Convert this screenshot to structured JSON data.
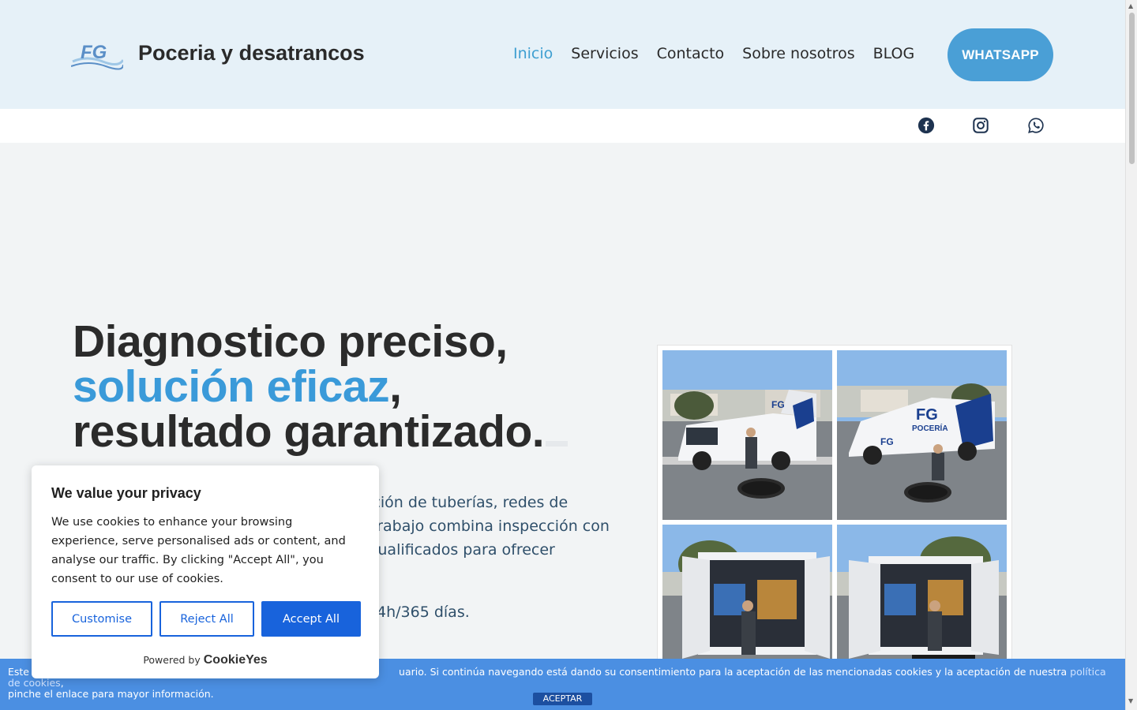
{
  "header": {
    "brand": "Poceria y desatrancos",
    "logo_text": "FG",
    "nav": [
      {
        "label": "Inicio",
        "active": true
      },
      {
        "label": "Servicios",
        "active": false
      },
      {
        "label": "Contacto",
        "active": false
      },
      {
        "label": "Sobre nosotros",
        "active": false
      },
      {
        "label": "BLOG",
        "active": false
      }
    ],
    "whatsapp_button": "WHATSAPP"
  },
  "social": {
    "icons": [
      "facebook-icon",
      "instagram-icon",
      "whatsapp-icon"
    ]
  },
  "hero": {
    "title_line1": "Diagnostico preciso,",
    "title_highlight": "solución eficaz",
    "title_comma": ",",
    "title_line3": "resultado garantizado.",
    "text_line1": "ración de tuberías, redes de",
    "text_line2": "e trabajo combina inspección con",
    "text_line3": "s cualificados para ofrecer",
    "text_line4": "4h/365 días.",
    "photos_alt": [
      "FG Poceria van with technician 1",
      "FG Poceria van with technician 2",
      "FG Poceria van rear doors 1",
      "FG Poceria van rear doors 2"
    ]
  },
  "consent": {
    "title": "We value your privacy",
    "body": "We use cookies to enhance your browsing experience, serve personalised ads or content, and analyse our traffic. By clicking \"Accept All\", you consent to our use of cookies.",
    "customise": "Customise",
    "reject": "Reject All",
    "accept": "Accept All",
    "powered_by": "Powered by",
    "powered_brand": "CookieYes"
  },
  "legacy_banner": {
    "text_left": "Este",
    "text_mid": "uario. Si continúa navegando está dando su consentimiento para la aceptación de las mencionadas cookies y la aceptación de nuestra",
    "link": "política de cookies",
    "text_end": ",",
    "line2": "pinche el enlace para mayor información.",
    "accept": "ACEPTAR"
  },
  "colors": {
    "accent": "#3a9ad9",
    "header_bg": "#e6f1f8",
    "consent_blue": "#1863dc",
    "banner_blue": "#4b8fe2"
  }
}
